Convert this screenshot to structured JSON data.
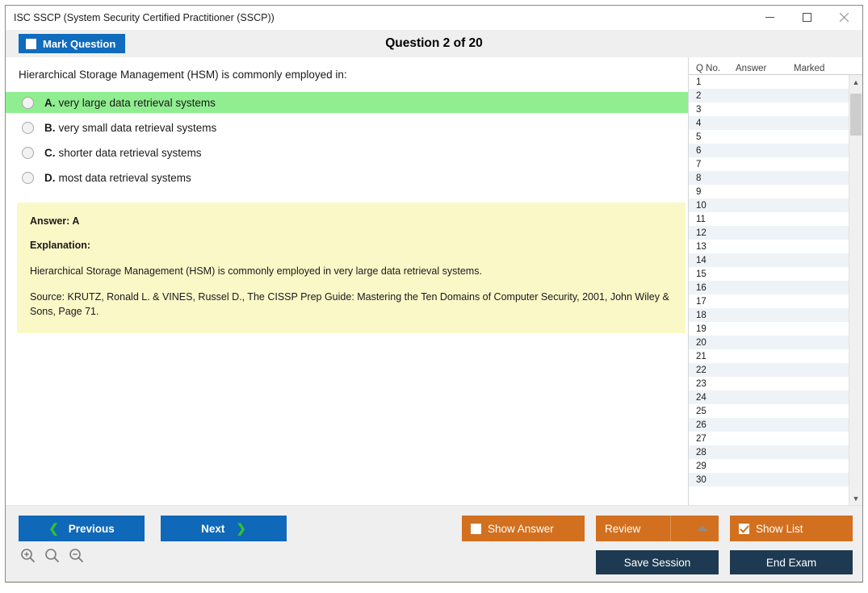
{
  "window": {
    "title": "ISC SSCP (System Security Certified Practitioner (SSCP))",
    "minimize_label": "minimize",
    "maximize_label": "maximize",
    "close_label": "close"
  },
  "header": {
    "mark_question_label": "Mark Question",
    "mark_question_checked": false,
    "question_counter": "Question 2 of 20"
  },
  "question": {
    "text": "Hierarchical Storage Management (HSM) is commonly employed in:",
    "options": [
      {
        "letter": "A.",
        "text": "very large data retrieval systems",
        "correct": true
      },
      {
        "letter": "B.",
        "text": "very small data retrieval systems",
        "correct": false
      },
      {
        "letter": "C.",
        "text": "shorter data retrieval systems",
        "correct": false
      },
      {
        "letter": "D.",
        "text": "most data retrieval systems",
        "correct": false
      }
    ]
  },
  "explanation": {
    "answer_label": "Answer: A",
    "explanation_label": "Explanation:",
    "body": "Hierarchical Storage Management (HSM) is commonly employed in very large data retrieval systems.",
    "source": "Source: KRUTZ, Ronald L. & VINES, Russel D., The CISSP Prep Guide: Mastering the Ten Domains of Computer Security, 2001, John Wiley & Sons, Page 71."
  },
  "question_list": {
    "columns": [
      "Q No.",
      "Answer",
      "Marked"
    ],
    "rows": [
      {
        "no": "1",
        "answer": "",
        "marked": ""
      },
      {
        "no": "2",
        "answer": "",
        "marked": ""
      },
      {
        "no": "3",
        "answer": "",
        "marked": ""
      },
      {
        "no": "4",
        "answer": "",
        "marked": ""
      },
      {
        "no": "5",
        "answer": "",
        "marked": ""
      },
      {
        "no": "6",
        "answer": "",
        "marked": ""
      },
      {
        "no": "7",
        "answer": "",
        "marked": ""
      },
      {
        "no": "8",
        "answer": "",
        "marked": ""
      },
      {
        "no": "9",
        "answer": "",
        "marked": ""
      },
      {
        "no": "10",
        "answer": "",
        "marked": ""
      },
      {
        "no": "11",
        "answer": "",
        "marked": ""
      },
      {
        "no": "12",
        "answer": "",
        "marked": ""
      },
      {
        "no": "13",
        "answer": "",
        "marked": ""
      },
      {
        "no": "14",
        "answer": "",
        "marked": ""
      },
      {
        "no": "15",
        "answer": "",
        "marked": ""
      },
      {
        "no": "16",
        "answer": "",
        "marked": ""
      },
      {
        "no": "17",
        "answer": "",
        "marked": ""
      },
      {
        "no": "18",
        "answer": "",
        "marked": ""
      },
      {
        "no": "19",
        "answer": "",
        "marked": ""
      },
      {
        "no": "20",
        "answer": "",
        "marked": ""
      },
      {
        "no": "21",
        "answer": "",
        "marked": ""
      },
      {
        "no": "22",
        "answer": "",
        "marked": ""
      },
      {
        "no": "23",
        "answer": "",
        "marked": ""
      },
      {
        "no": "24",
        "answer": "",
        "marked": ""
      },
      {
        "no": "25",
        "answer": "",
        "marked": ""
      },
      {
        "no": "26",
        "answer": "",
        "marked": ""
      },
      {
        "no": "27",
        "answer": "",
        "marked": ""
      },
      {
        "no": "28",
        "answer": "",
        "marked": ""
      },
      {
        "no": "29",
        "answer": "",
        "marked": ""
      },
      {
        "no": "30",
        "answer": "",
        "marked": ""
      }
    ]
  },
  "footer": {
    "previous_label": "Previous",
    "next_label": "Next",
    "show_answer_label": "Show Answer",
    "show_answer_checked": false,
    "review_label": "Review",
    "show_list_label": "Show List",
    "show_list_checked": true,
    "save_session_label": "Save Session",
    "end_exam_label": "End Exam",
    "zoom_in_label": "zoom-in",
    "zoom_reset_label": "zoom-reset",
    "zoom_out_label": "zoom-out"
  },
  "colors": {
    "accent_blue": "#1068b8",
    "accent_orange": "#d2701f",
    "dark_navy": "#1d3a52",
    "correct_green": "#90ee90",
    "explanation_yellow": "#fbf8c8"
  }
}
